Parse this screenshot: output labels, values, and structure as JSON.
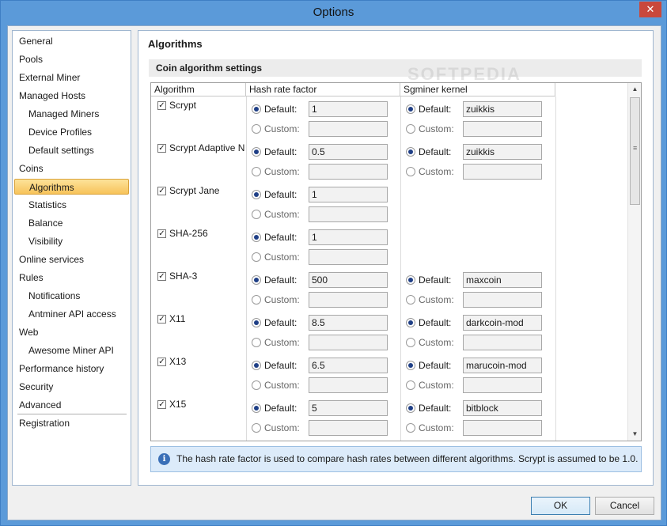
{
  "window": {
    "title": "Options",
    "close_glyph": "✕"
  },
  "sidebar": {
    "items": [
      {
        "label": "General",
        "level": "top"
      },
      {
        "label": "Pools",
        "level": "top"
      },
      {
        "label": "External Miner",
        "level": "top"
      },
      {
        "label": "Managed Hosts",
        "level": "top"
      },
      {
        "label": "Managed Miners",
        "level": "sub"
      },
      {
        "label": "Device Profiles",
        "level": "sub"
      },
      {
        "label": "Default settings",
        "level": "sub"
      },
      {
        "label": "Coins",
        "level": "top"
      },
      {
        "label": "Algorithms",
        "level": "sub",
        "active": true
      },
      {
        "label": "Statistics",
        "level": "sub"
      },
      {
        "label": "Balance",
        "level": "sub"
      },
      {
        "label": "Visibility",
        "level": "sub"
      },
      {
        "label": "Online services",
        "level": "top"
      },
      {
        "label": "Rules",
        "level": "top"
      },
      {
        "label": "Notifications",
        "level": "sub"
      },
      {
        "label": "Antminer API access",
        "level": "sub"
      },
      {
        "label": "Web",
        "level": "top"
      },
      {
        "label": "Awesome Miner API",
        "level": "sub"
      },
      {
        "label": "Performance history",
        "level": "top"
      },
      {
        "label": "Security",
        "level": "top"
      },
      {
        "label": "Advanced",
        "level": "top"
      },
      {
        "label": "Registration",
        "level": "top"
      }
    ]
  },
  "main": {
    "title": "Algorithms",
    "section": "Coin algorithm settings",
    "columns": [
      "Algorithm",
      "Hash rate factor",
      "Sgminer kernel"
    ],
    "default_label": "Default:",
    "custom_label": "Custom:",
    "rows": [
      {
        "name": "Scrypt",
        "checked": true,
        "hash_default": "1",
        "kernel": "zuikkis"
      },
      {
        "name": "Scrypt Adaptive N",
        "checked": true,
        "hash_default": "0.5",
        "kernel": "zuikkis"
      },
      {
        "name": "Scrypt Jane",
        "checked": true,
        "hash_default": "1",
        "kernel": null
      },
      {
        "name": "SHA-256",
        "checked": true,
        "hash_default": "1",
        "kernel": null
      },
      {
        "name": "SHA-3",
        "checked": true,
        "hash_default": "500",
        "kernel": "maxcoin"
      },
      {
        "name": "X11",
        "checked": true,
        "hash_default": "8.5",
        "kernel": "darkcoin-mod"
      },
      {
        "name": "X13",
        "checked": true,
        "hash_default": "6.5",
        "kernel": "marucoin-mod"
      },
      {
        "name": "X15",
        "checked": true,
        "hash_default": "5",
        "kernel": "bitblock"
      }
    ],
    "info_text": "The hash rate factor is used to compare hash rates between different algorithms. Scrypt is assumed to be 1.0.",
    "watermark": "SOFTPEDIA"
  },
  "footer": {
    "ok_label": "OK",
    "cancel_label": "Cancel"
  }
}
